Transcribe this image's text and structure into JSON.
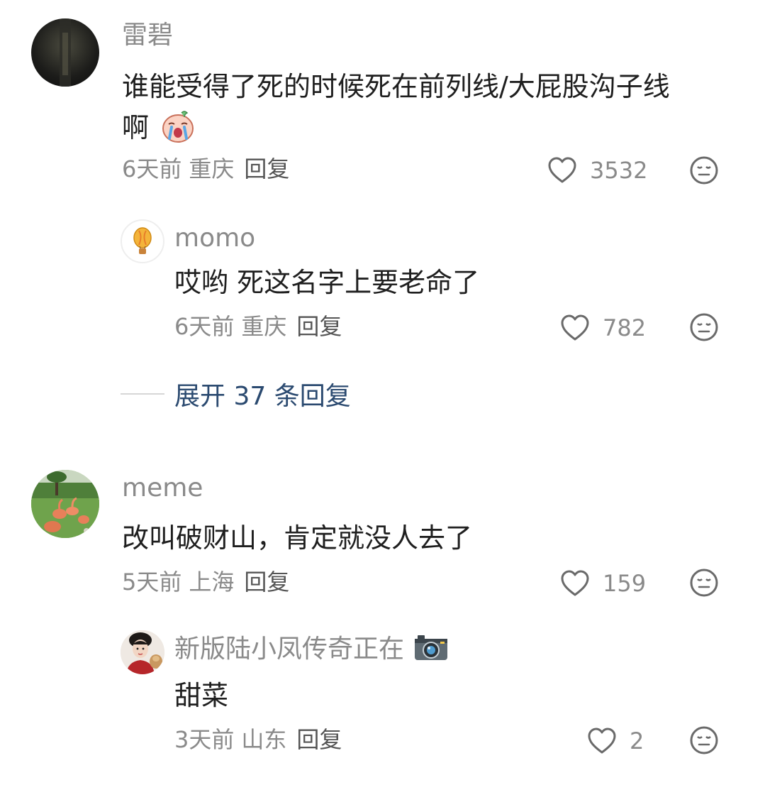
{
  "comments": [
    {
      "username": "雷碧",
      "text_line1": "谁能受得了死的时候死在前列线/大屁股沟子线",
      "text_line2": "啊",
      "sticker_icon": "crying-face-sticker-icon",
      "time": "6天前",
      "location": "重庆",
      "reply_label": "回复",
      "likes": "3532",
      "replies": [
        {
          "username": "momo",
          "text": "哎哟  死这名字上要老命了",
          "time": "6天前",
          "location": "重庆",
          "reply_label": "回复",
          "likes": "782"
        }
      ],
      "expand_label": "展开 37 条回复"
    },
    {
      "username": "meme",
      "text": "改叫破财山，肯定就没人去了",
      "time": "5天前",
      "location": "上海",
      "reply_label": "回复",
      "likes": "159",
      "replies": [
        {
          "username": "新版陆小凤传奇正在",
          "username_icon": "camera-icon",
          "text": "甜菜",
          "time": "3天前",
          "location": "山东",
          "reply_label": "回复",
          "likes": "2"
        }
      ]
    }
  ],
  "colors": {
    "meta_gray": "#8a8a8a",
    "expand_blue": "#2b4a70",
    "text": "#1f1f1f"
  }
}
